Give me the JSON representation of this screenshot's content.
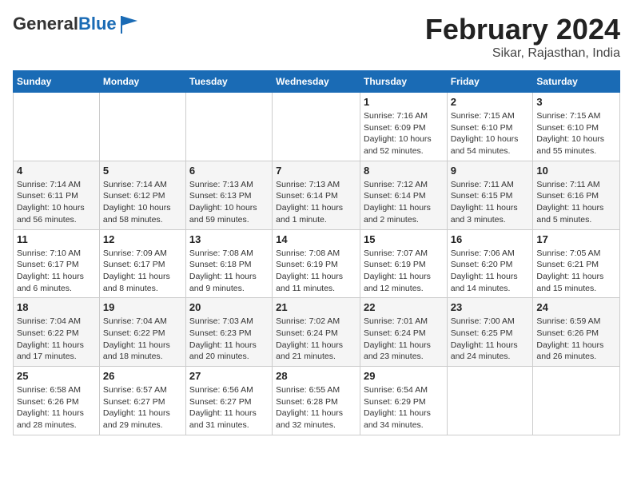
{
  "header": {
    "logo_general": "General",
    "logo_blue": "Blue",
    "month_year": "February 2024",
    "location": "Sikar, Rajasthan, India"
  },
  "days_of_week": [
    "Sunday",
    "Monday",
    "Tuesday",
    "Wednesday",
    "Thursday",
    "Friday",
    "Saturday"
  ],
  "weeks": [
    [
      {
        "day": "",
        "info": ""
      },
      {
        "day": "",
        "info": ""
      },
      {
        "day": "",
        "info": ""
      },
      {
        "day": "",
        "info": ""
      },
      {
        "day": "1",
        "info": "Sunrise: 7:16 AM\nSunset: 6:09 PM\nDaylight: 10 hours\nand 52 minutes."
      },
      {
        "day": "2",
        "info": "Sunrise: 7:15 AM\nSunset: 6:10 PM\nDaylight: 10 hours\nand 54 minutes."
      },
      {
        "day": "3",
        "info": "Sunrise: 7:15 AM\nSunset: 6:10 PM\nDaylight: 10 hours\nand 55 minutes."
      }
    ],
    [
      {
        "day": "4",
        "info": "Sunrise: 7:14 AM\nSunset: 6:11 PM\nDaylight: 10 hours\nand 56 minutes."
      },
      {
        "day": "5",
        "info": "Sunrise: 7:14 AM\nSunset: 6:12 PM\nDaylight: 10 hours\nand 58 minutes."
      },
      {
        "day": "6",
        "info": "Sunrise: 7:13 AM\nSunset: 6:13 PM\nDaylight: 10 hours\nand 59 minutes."
      },
      {
        "day": "7",
        "info": "Sunrise: 7:13 AM\nSunset: 6:14 PM\nDaylight: 11 hours\nand 1 minute."
      },
      {
        "day": "8",
        "info": "Sunrise: 7:12 AM\nSunset: 6:14 PM\nDaylight: 11 hours\nand 2 minutes."
      },
      {
        "day": "9",
        "info": "Sunrise: 7:11 AM\nSunset: 6:15 PM\nDaylight: 11 hours\nand 3 minutes."
      },
      {
        "day": "10",
        "info": "Sunrise: 7:11 AM\nSunset: 6:16 PM\nDaylight: 11 hours\nand 5 minutes."
      }
    ],
    [
      {
        "day": "11",
        "info": "Sunrise: 7:10 AM\nSunset: 6:17 PM\nDaylight: 11 hours\nand 6 minutes."
      },
      {
        "day": "12",
        "info": "Sunrise: 7:09 AM\nSunset: 6:17 PM\nDaylight: 11 hours\nand 8 minutes."
      },
      {
        "day": "13",
        "info": "Sunrise: 7:08 AM\nSunset: 6:18 PM\nDaylight: 11 hours\nand 9 minutes."
      },
      {
        "day": "14",
        "info": "Sunrise: 7:08 AM\nSunset: 6:19 PM\nDaylight: 11 hours\nand 11 minutes."
      },
      {
        "day": "15",
        "info": "Sunrise: 7:07 AM\nSunset: 6:19 PM\nDaylight: 11 hours\nand 12 minutes."
      },
      {
        "day": "16",
        "info": "Sunrise: 7:06 AM\nSunset: 6:20 PM\nDaylight: 11 hours\nand 14 minutes."
      },
      {
        "day": "17",
        "info": "Sunrise: 7:05 AM\nSunset: 6:21 PM\nDaylight: 11 hours\nand 15 minutes."
      }
    ],
    [
      {
        "day": "18",
        "info": "Sunrise: 7:04 AM\nSunset: 6:22 PM\nDaylight: 11 hours\nand 17 minutes."
      },
      {
        "day": "19",
        "info": "Sunrise: 7:04 AM\nSunset: 6:22 PM\nDaylight: 11 hours\nand 18 minutes."
      },
      {
        "day": "20",
        "info": "Sunrise: 7:03 AM\nSunset: 6:23 PM\nDaylight: 11 hours\nand 20 minutes."
      },
      {
        "day": "21",
        "info": "Sunrise: 7:02 AM\nSunset: 6:24 PM\nDaylight: 11 hours\nand 21 minutes."
      },
      {
        "day": "22",
        "info": "Sunrise: 7:01 AM\nSunset: 6:24 PM\nDaylight: 11 hours\nand 23 minutes."
      },
      {
        "day": "23",
        "info": "Sunrise: 7:00 AM\nSunset: 6:25 PM\nDaylight: 11 hours\nand 24 minutes."
      },
      {
        "day": "24",
        "info": "Sunrise: 6:59 AM\nSunset: 6:26 PM\nDaylight: 11 hours\nand 26 minutes."
      }
    ],
    [
      {
        "day": "25",
        "info": "Sunrise: 6:58 AM\nSunset: 6:26 PM\nDaylight: 11 hours\nand 28 minutes."
      },
      {
        "day": "26",
        "info": "Sunrise: 6:57 AM\nSunset: 6:27 PM\nDaylight: 11 hours\nand 29 minutes."
      },
      {
        "day": "27",
        "info": "Sunrise: 6:56 AM\nSunset: 6:27 PM\nDaylight: 11 hours\nand 31 minutes."
      },
      {
        "day": "28",
        "info": "Sunrise: 6:55 AM\nSunset: 6:28 PM\nDaylight: 11 hours\nand 32 minutes."
      },
      {
        "day": "29",
        "info": "Sunrise: 6:54 AM\nSunset: 6:29 PM\nDaylight: 11 hours\nand 34 minutes."
      },
      {
        "day": "",
        "info": ""
      },
      {
        "day": "",
        "info": ""
      }
    ]
  ]
}
